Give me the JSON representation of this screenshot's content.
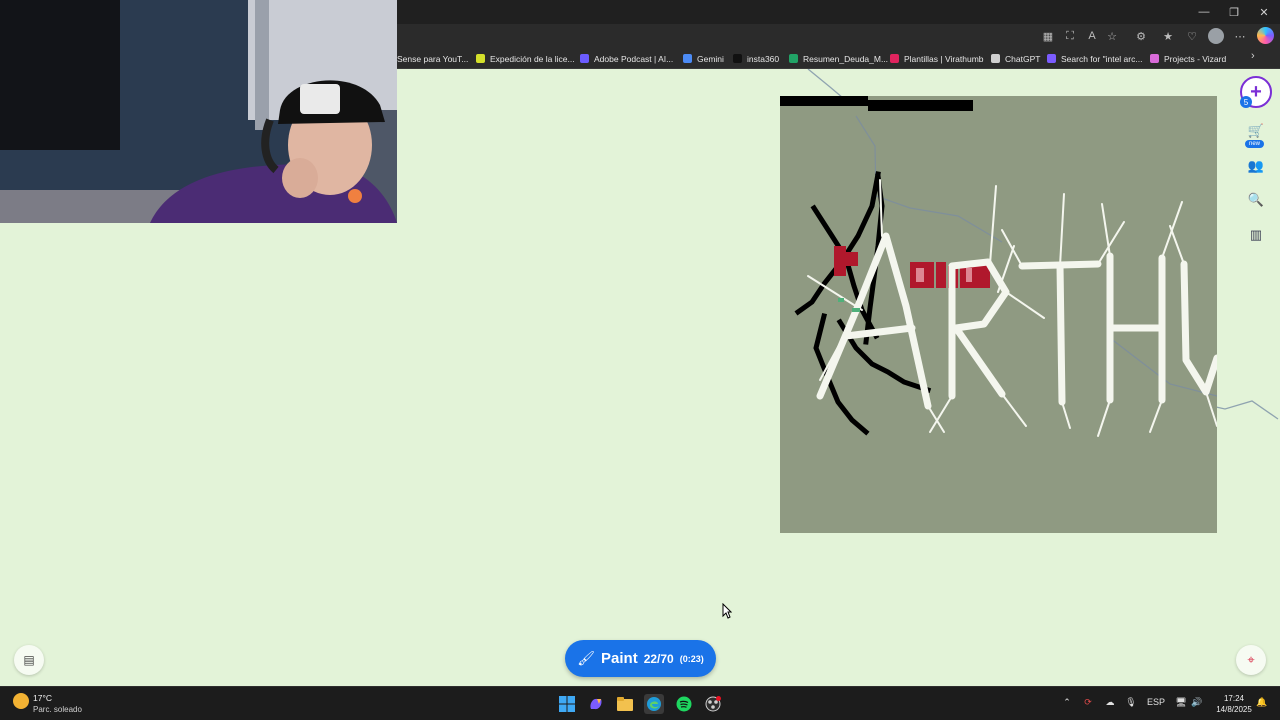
{
  "browser": {
    "window_controls": {
      "minimize": "—",
      "maximize": "❐",
      "close": "✕"
    },
    "bookmarks": [
      {
        "label": "Sense para YouT...",
        "color": "#2b2b2b"
      },
      {
        "label": "Expedición de la lice...",
        "color": "#d4e02b"
      },
      {
        "label": "Adobe Podcast | AI...",
        "color": "#6b5cff"
      },
      {
        "label": "Gemini",
        "color": "#4c8bf5"
      },
      {
        "label": "insta360",
        "color": "#111111"
      },
      {
        "label": "Resumen_Deuda_M...",
        "color": "#21a366"
      },
      {
        "label": "Plantillas | Virathumb",
        "color": "#e0245e"
      },
      {
        "label": "ChatGPT",
        "color": "#cfcfcf"
      },
      {
        "label": "Search for \"intel arc...",
        "color": "#7b5cff"
      },
      {
        "label": "Projects - Vizard",
        "color": "#d96bd9"
      }
    ],
    "bookmarks_more": "›"
  },
  "page": {
    "background_color": "#e3f3d8",
    "artwork_text": "ARTHUR",
    "right_toolbar": [
      {
        "name": "cart-icon",
        "glyph": "🛒"
      },
      {
        "name": "people-icon",
        "glyph": "👥"
      },
      {
        "name": "search-zoom-icon",
        "glyph": "🔍"
      },
      {
        "name": "leaderboard-icon",
        "glyph": "▥"
      }
    ],
    "user_level": "5",
    "new_badge": "new",
    "paint_button": {
      "label": "Paint",
      "count": "22/70",
      "timer": "(0:23)"
    }
  },
  "taskbar": {
    "weather": {
      "temp": "17°C",
      "desc": "Parc. soleado"
    },
    "language": "ESP",
    "time": "17:24",
    "date": "14/8/2025"
  },
  "colors": {
    "accent": "#1a73e8",
    "canvas_bg": "#8f9a82",
    "art_white": "#f4f6ee",
    "art_red": "#b0182c"
  }
}
